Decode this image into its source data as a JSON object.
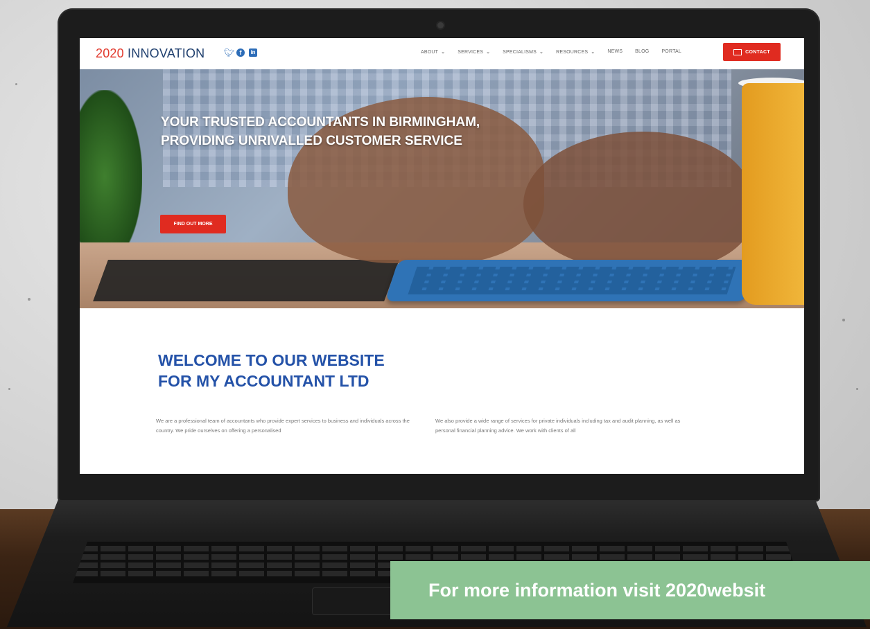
{
  "site": {
    "logo_number": "2020",
    "logo_text": " INNOVATION",
    "social_icons": [
      "twitter-icon",
      "facebook-icon",
      "linkedin-icon"
    ]
  },
  "nav": {
    "items": [
      {
        "label": "ABOUT",
        "has_dropdown": true
      },
      {
        "label": "SERVICES",
        "has_dropdown": true
      },
      {
        "label": "SPECIALISMS",
        "has_dropdown": true
      },
      {
        "label": "RESOURCES",
        "has_dropdown": true
      },
      {
        "label": "NEWS",
        "has_dropdown": false
      },
      {
        "label": "BLOG",
        "has_dropdown": false
      },
      {
        "label": "PORTAL",
        "has_dropdown": false
      }
    ],
    "chevron": "⌄",
    "contact_label": "CONTACT"
  },
  "hero": {
    "title": "YOUR TRUSTED ACCOUNTANTS IN BIRMINGHAM, PROVIDING UNRIVALLED CUSTOMER SERVICE",
    "button_label": "FIND OUT MORE"
  },
  "welcome": {
    "title_line1": "WELCOME TO OUR WEBSITE",
    "title_line2": "FOR MY ACCOUNTANT LTD",
    "para1": "We are a professional team of accountants who provide expert services to business and individuals across the country. We pride ourselves on offering a personalised",
    "para2": "We also provide a wide range of services for private individuals including tax and audit planning, as well as personal financial planning advice. We work with clients of all"
  },
  "banner": {
    "text": "For more information visit 2020websit"
  },
  "colors": {
    "brand_red": "#e02b20",
    "brand_blue": "#2452a8",
    "banner_green": "#8cc393"
  }
}
